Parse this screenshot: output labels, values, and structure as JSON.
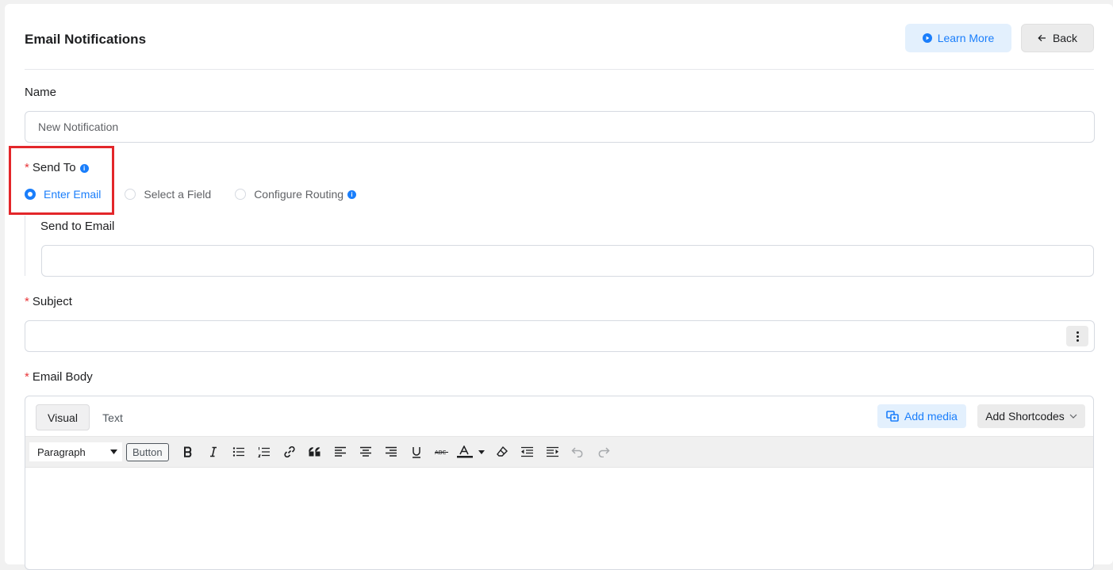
{
  "header": {
    "title": "Email Notifications",
    "learn_more_label": "Learn More",
    "back_label": "Back"
  },
  "name_field": {
    "label": "Name",
    "value": "New Notification"
  },
  "send_to": {
    "label": "Send To",
    "options": [
      {
        "label": "Enter Email",
        "checked": true
      },
      {
        "label": "Select a Field",
        "checked": false
      },
      {
        "label": "Configure Routing",
        "checked": false
      }
    ],
    "send_to_email_label": "Send to Email",
    "send_to_email_value": ""
  },
  "subject": {
    "label": "Subject",
    "value": ""
  },
  "email_body": {
    "label": "Email Body",
    "tab_visual": "Visual",
    "tab_text": "Text",
    "add_media_label": "Add media",
    "add_shortcodes_label": "Add Shortcodes",
    "format_selected": "Paragraph",
    "inline_button_label": "Button",
    "toolbar_icons": [
      "bold-icon",
      "italic-icon",
      "bullet-list-icon",
      "numbered-list-icon",
      "link-icon",
      "blockquote-icon",
      "align-left-icon",
      "align-center-icon",
      "align-right-icon",
      "underline-icon",
      "strikethrough-icon",
      "text-color-icon",
      "clear-formatting-icon",
      "outdent-icon",
      "indent-icon",
      "undo-icon",
      "redo-icon"
    ]
  },
  "colors": {
    "accent": "#1a7efb",
    "required": "#e8373a",
    "highlight": "#e3262a"
  }
}
